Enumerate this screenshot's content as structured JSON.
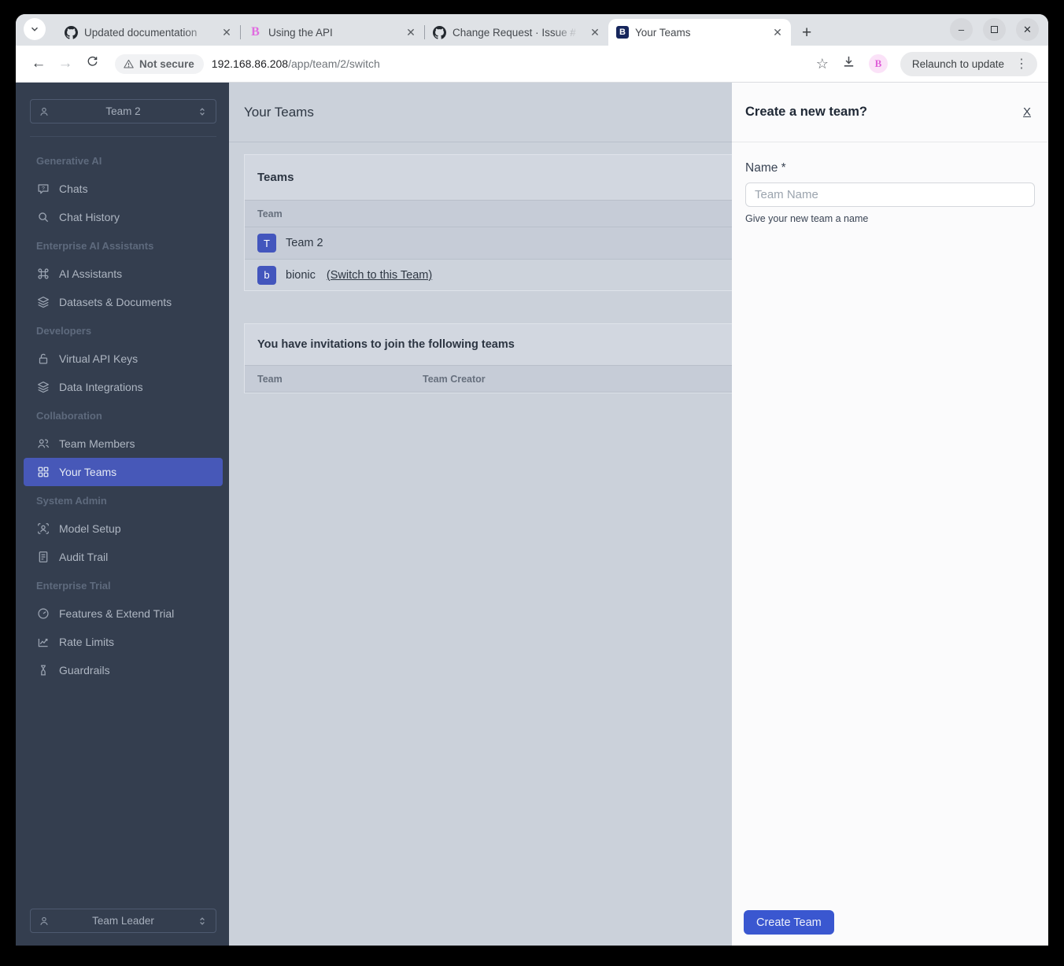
{
  "chrome": {
    "tabs": [
      {
        "title": "Updated documentation",
        "icon": "github-icon"
      },
      {
        "title": "Using the API",
        "icon": "b-pink-icon"
      },
      {
        "title": "Change Request · Issue #",
        "icon": "github-icon"
      },
      {
        "title": "Your Teams",
        "icon": "b-navy-icon"
      }
    ],
    "tab_favicon_letter_pink": "B",
    "tab_favicon_letter_navy": "B",
    "new_tab_glyph": "+",
    "close_glyph": "✕",
    "controls": {
      "minimize": "–",
      "close": "✕"
    },
    "icons": {
      "back": "←",
      "forward": "→",
      "star": "☆",
      "kebab": "⋮",
      "tab_search": "⌄"
    },
    "security_chip": "Not secure",
    "url_host": "192.168.86.208",
    "url_path": "/app/team/2/switch",
    "extension_letter": "B",
    "relaunch_label": "Relaunch to update"
  },
  "sidebar": {
    "team_selector": "Team 2",
    "role_selector": "Team Leader",
    "sections": [
      {
        "header": "Generative AI",
        "items": [
          {
            "label": "Chats",
            "icon": "chat-question-icon"
          },
          {
            "label": "Chat History",
            "icon": "search-icon"
          }
        ]
      },
      {
        "header": "Enterprise AI Assistants",
        "items": [
          {
            "label": "AI Assistants",
            "icon": "command-icon"
          },
          {
            "label": "Datasets & Documents",
            "icon": "layers-icon"
          }
        ]
      },
      {
        "header": "Developers",
        "items": [
          {
            "label": "Virtual API Keys",
            "icon": "lock-open-icon"
          },
          {
            "label": "Data Integrations",
            "icon": "layers-icon"
          }
        ]
      },
      {
        "header": "Collaboration",
        "items": [
          {
            "label": "Team Members",
            "icon": "users-icon"
          },
          {
            "label": "Your Teams",
            "icon": "grid-icon",
            "active": true
          }
        ]
      },
      {
        "header": "System Admin",
        "items": [
          {
            "label": "Model Setup",
            "icon": "user-scan-icon"
          },
          {
            "label": "Audit Trail",
            "icon": "document-icon"
          }
        ]
      },
      {
        "header": "Enterprise Trial",
        "items": [
          {
            "label": "Features & Extend Trial",
            "icon": "clock-icon"
          },
          {
            "label": "Rate Limits",
            "icon": "chart-icon"
          },
          {
            "label": "Guardrails",
            "icon": "hourglass-icon"
          }
        ]
      }
    ]
  },
  "main": {
    "page_title": "Your Teams",
    "teams_card": {
      "title": "Teams",
      "column_header": "Team",
      "rows": [
        {
          "avatar": "T",
          "name": "Team 2",
          "link": ""
        },
        {
          "avatar": "b",
          "name": "bionic",
          "link": "(Switch to this Team)"
        }
      ]
    },
    "invitations_card": {
      "title": "You have invitations to join the following teams",
      "columns": [
        "Team",
        "Team Creator"
      ]
    }
  },
  "drawer": {
    "title": "Create a new team?",
    "close_label": "X",
    "name_label": "Name *",
    "name_placeholder": "Team Name",
    "name_help": "Give your new team a name",
    "submit_label": "Create Team"
  },
  "colors": {
    "accent_indigo": "#4758b8",
    "button_blue": "#3a57d0",
    "sidebar_bg": "#343e4f",
    "main_bg": "#cbd1da",
    "tabstrip_bg": "#dfe2e6",
    "drawer_bg": "#fbfbfc",
    "pink_logo": "#e06ce0",
    "navy_favicon": "#16265c"
  }
}
